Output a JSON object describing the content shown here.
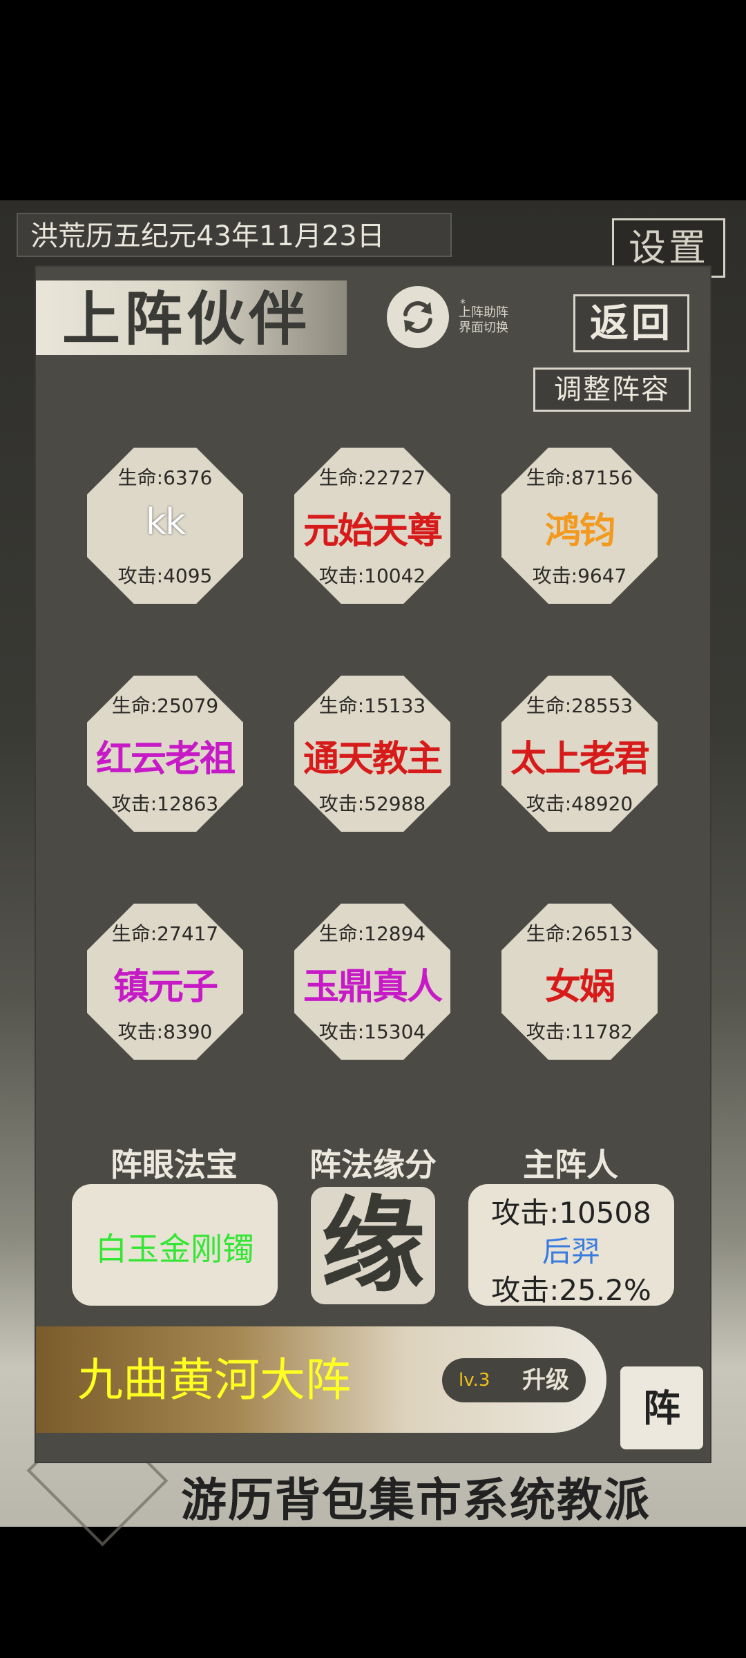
{
  "background": {
    "date": "洪荒历五纪元43年11月23日",
    "settings_label": "设置",
    "nav_strip": "游历背包集市系统教派"
  },
  "panel": {
    "title": "上阵伙伴",
    "switch_note": "上阵助阵\n界面切换",
    "back_label": "返回",
    "adjust_label": "调整阵容"
  },
  "companions": [
    {
      "hp": "生命:6376",
      "name": "kk",
      "atk": "攻击:4095",
      "color": "#ffffff"
    },
    {
      "hp": "生命:22727",
      "name": "元始天尊",
      "atk": "攻击:10042",
      "color": "#d71a1a"
    },
    {
      "hp": "生命:87156",
      "name": "鸿钧",
      "atk": "攻击:9647",
      "color": "#f39a1e"
    },
    {
      "hp": "生命:25079",
      "name": "红云老祖",
      "atk": "攻击:12863",
      "color": "#c71ac7"
    },
    {
      "hp": "生命:15133",
      "name": "通天教主",
      "atk": "攻击:52988",
      "color": "#d71a1a"
    },
    {
      "hp": "生命:28553",
      "name": "太上老君",
      "atk": "攻击:48920",
      "color": "#d71a1a"
    },
    {
      "hp": "生命:27417",
      "name": "镇元子",
      "atk": "攻击:8390",
      "color": "#c71ac7"
    },
    {
      "hp": "生命:12894",
      "name": "玉鼎真人",
      "atk": "攻击:15304",
      "color": "#c71ac7"
    },
    {
      "hp": "生命:26513",
      "name": "女娲",
      "atk": "攻击:11782",
      "color": "#d71a1a"
    }
  ],
  "bottom": {
    "treasure_label": "阵眼法宝",
    "treasure_name": "白玉金刚镯",
    "fate_label": "阵法缘分",
    "fate_char": "缘",
    "master_label": "主阵人",
    "master_attack": "攻击:10508",
    "master_name": "后羿",
    "master_bonus": "攻击:25.2%"
  },
  "formation": {
    "name": "九曲黄河大阵",
    "level": "lv.3",
    "upgrade_label": "升级",
    "button_label": "阵"
  }
}
